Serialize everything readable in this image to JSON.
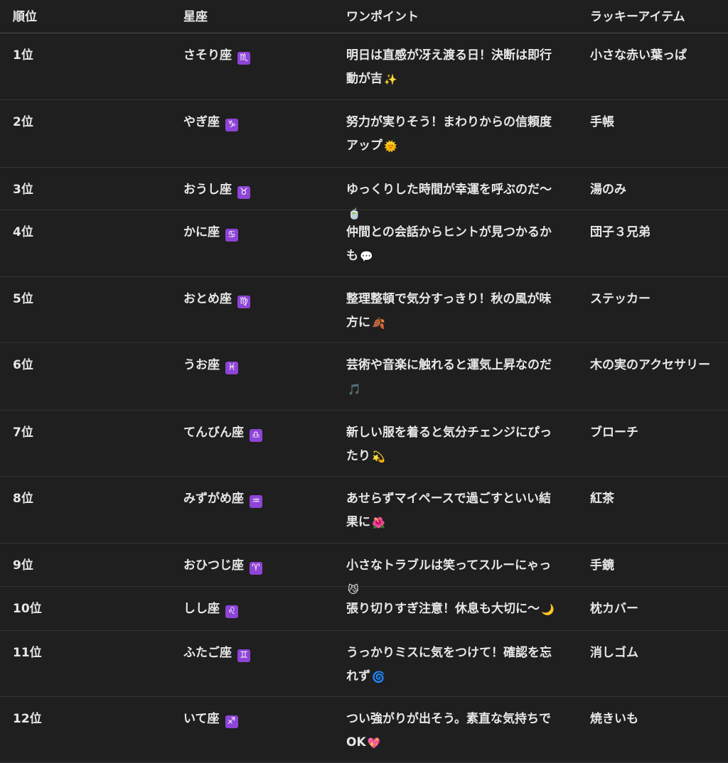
{
  "header": {
    "rank": "順位",
    "sign": "星座",
    "tip": "ワンポイント",
    "item": "ラッキーアイテム"
  },
  "rows": [
    {
      "rank": "1位",
      "sign": "さそり座",
      "symbol": "♏",
      "tip": "明日は直感が冴え渡る日！決断は即行動が吉",
      "tip_emoji": "✨",
      "item": "小さな赤い葉っぱ"
    },
    {
      "rank": "2位",
      "sign": "やぎ座",
      "symbol": "♑",
      "tip": "努力が実りそう！まわりからの信頼度アップ",
      "tip_emoji": "🌞",
      "item": "手帳"
    },
    {
      "rank": "3位",
      "sign": "おうし座",
      "symbol": "♉",
      "tip": "ゆっくりした時間が幸運を呼ぶのだ〜",
      "tip_emoji": "🍵",
      "item": "湯のみ"
    },
    {
      "rank": "4位",
      "sign": "かに座",
      "symbol": "♋",
      "tip": "仲間との会話からヒントが見つかるかも",
      "tip_emoji": "💬",
      "item": "団子３兄弟"
    },
    {
      "rank": "5位",
      "sign": "おとめ座",
      "symbol": "♍",
      "tip": "整理整頓で気分すっきり！秋の風が味方に",
      "tip_emoji": "🍂",
      "item": "ステッカー"
    },
    {
      "rank": "6位",
      "sign": "うお座",
      "symbol": "♓",
      "tip": "芸術や音楽に触れると運気上昇なのだ",
      "tip_emoji": "🎵",
      "item": "木の実のアクセサリー"
    },
    {
      "rank": "7位",
      "sign": "てんびん座",
      "symbol": "♎",
      "tip": "新しい服を着ると気分チェンジにぴったり",
      "tip_emoji": "💫",
      "item": "ブローチ"
    },
    {
      "rank": "8位",
      "sign": "みずがめ座",
      "symbol": "♒",
      "tip": "あせらずマイペースで過ごすといい結果に",
      "tip_emoji": "🌺",
      "item": "紅茶"
    },
    {
      "rank": "9位",
      "sign": "おひつじ座",
      "symbol": "♈",
      "tip": "小さなトラブルは笑ってスルーにゃっ",
      "tip_emoji": "😼",
      "item": "手鏡"
    },
    {
      "rank": "10位",
      "sign": "しし座",
      "symbol": "♌",
      "tip": "張り切りすぎ注意！休息も大切に〜",
      "tip_emoji": "🌙",
      "item": "枕カバー"
    },
    {
      "rank": "11位",
      "sign": "ふたご座",
      "symbol": "♊",
      "tip": "うっかりミスに気をつけて！確認を忘れず",
      "tip_emoji": "🌀",
      "item": "消しゴム"
    },
    {
      "rank": "12位",
      "sign": "いて座",
      "symbol": "♐",
      "tip": "つい強がりが出そう。素直な気持ちでOK",
      "tip_emoji": "💖",
      "item": "焼きいも"
    }
  ],
  "colors": {
    "background": "#1f1f20",
    "text": "#e8e8e8",
    "zodiac_badge": "#8e44d6"
  }
}
